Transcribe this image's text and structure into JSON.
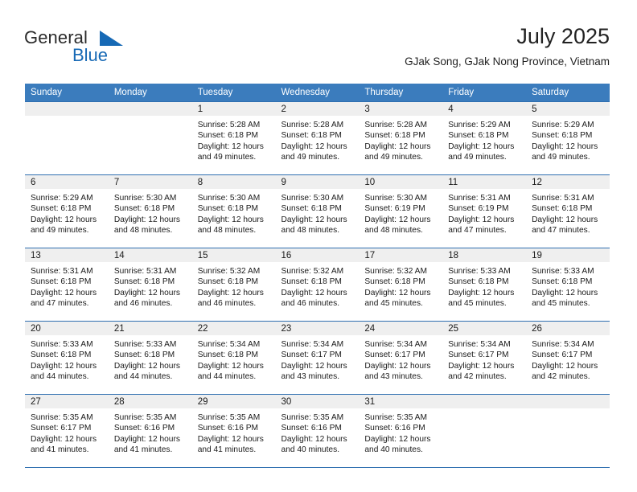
{
  "brand": {
    "name_part1": "General",
    "name_part2": "Blue",
    "triangle_icon": "blue-triangle-icon",
    "accent_color": "#1669b5"
  },
  "header": {
    "title": "July 2025",
    "subtitle": "GJak Song, GJak Nong Province, Vietnam"
  },
  "theme": {
    "header_row_bg": "#3b7cbd",
    "row_border": "#2f6fb0",
    "daynum_band_bg": "#efefef",
    "text_color": "#1a1a1a"
  },
  "weekday_headers": [
    "Sunday",
    "Monday",
    "Tuesday",
    "Wednesday",
    "Thursday",
    "Friday",
    "Saturday"
  ],
  "weeks": [
    [
      {
        "day": "",
        "empty": true,
        "sunrise": "",
        "sunset": "",
        "daylight1": "",
        "daylight2": ""
      },
      {
        "day": "",
        "empty": true,
        "sunrise": "",
        "sunset": "",
        "daylight1": "",
        "daylight2": ""
      },
      {
        "day": "1",
        "empty": false,
        "sunrise": "Sunrise: 5:28 AM",
        "sunset": "Sunset: 6:18 PM",
        "daylight1": "Daylight: 12 hours",
        "daylight2": "and 49 minutes."
      },
      {
        "day": "2",
        "empty": false,
        "sunrise": "Sunrise: 5:28 AM",
        "sunset": "Sunset: 6:18 PM",
        "daylight1": "Daylight: 12 hours",
        "daylight2": "and 49 minutes."
      },
      {
        "day": "3",
        "empty": false,
        "sunrise": "Sunrise: 5:28 AM",
        "sunset": "Sunset: 6:18 PM",
        "daylight1": "Daylight: 12 hours",
        "daylight2": "and 49 minutes."
      },
      {
        "day": "4",
        "empty": false,
        "sunrise": "Sunrise: 5:29 AM",
        "sunset": "Sunset: 6:18 PM",
        "daylight1": "Daylight: 12 hours",
        "daylight2": "and 49 minutes."
      },
      {
        "day": "5",
        "empty": false,
        "sunrise": "Sunrise: 5:29 AM",
        "sunset": "Sunset: 6:18 PM",
        "daylight1": "Daylight: 12 hours",
        "daylight2": "and 49 minutes."
      }
    ],
    [
      {
        "day": "6",
        "empty": false,
        "sunrise": "Sunrise: 5:29 AM",
        "sunset": "Sunset: 6:18 PM",
        "daylight1": "Daylight: 12 hours",
        "daylight2": "and 49 minutes."
      },
      {
        "day": "7",
        "empty": false,
        "sunrise": "Sunrise: 5:30 AM",
        "sunset": "Sunset: 6:18 PM",
        "daylight1": "Daylight: 12 hours",
        "daylight2": "and 48 minutes."
      },
      {
        "day": "8",
        "empty": false,
        "sunrise": "Sunrise: 5:30 AM",
        "sunset": "Sunset: 6:18 PM",
        "daylight1": "Daylight: 12 hours",
        "daylight2": "and 48 minutes."
      },
      {
        "day": "9",
        "empty": false,
        "sunrise": "Sunrise: 5:30 AM",
        "sunset": "Sunset: 6:18 PM",
        "daylight1": "Daylight: 12 hours",
        "daylight2": "and 48 minutes."
      },
      {
        "day": "10",
        "empty": false,
        "sunrise": "Sunrise: 5:30 AM",
        "sunset": "Sunset: 6:19 PM",
        "daylight1": "Daylight: 12 hours",
        "daylight2": "and 48 minutes."
      },
      {
        "day": "11",
        "empty": false,
        "sunrise": "Sunrise: 5:31 AM",
        "sunset": "Sunset: 6:19 PM",
        "daylight1": "Daylight: 12 hours",
        "daylight2": "and 47 minutes."
      },
      {
        "day": "12",
        "empty": false,
        "sunrise": "Sunrise: 5:31 AM",
        "sunset": "Sunset: 6:18 PM",
        "daylight1": "Daylight: 12 hours",
        "daylight2": "and 47 minutes."
      }
    ],
    [
      {
        "day": "13",
        "empty": false,
        "sunrise": "Sunrise: 5:31 AM",
        "sunset": "Sunset: 6:18 PM",
        "daylight1": "Daylight: 12 hours",
        "daylight2": "and 47 minutes."
      },
      {
        "day": "14",
        "empty": false,
        "sunrise": "Sunrise: 5:31 AM",
        "sunset": "Sunset: 6:18 PM",
        "daylight1": "Daylight: 12 hours",
        "daylight2": "and 46 minutes."
      },
      {
        "day": "15",
        "empty": false,
        "sunrise": "Sunrise: 5:32 AM",
        "sunset": "Sunset: 6:18 PM",
        "daylight1": "Daylight: 12 hours",
        "daylight2": "and 46 minutes."
      },
      {
        "day": "16",
        "empty": false,
        "sunrise": "Sunrise: 5:32 AM",
        "sunset": "Sunset: 6:18 PM",
        "daylight1": "Daylight: 12 hours",
        "daylight2": "and 46 minutes."
      },
      {
        "day": "17",
        "empty": false,
        "sunrise": "Sunrise: 5:32 AM",
        "sunset": "Sunset: 6:18 PM",
        "daylight1": "Daylight: 12 hours",
        "daylight2": "and 45 minutes."
      },
      {
        "day": "18",
        "empty": false,
        "sunrise": "Sunrise: 5:33 AM",
        "sunset": "Sunset: 6:18 PM",
        "daylight1": "Daylight: 12 hours",
        "daylight2": "and 45 minutes."
      },
      {
        "day": "19",
        "empty": false,
        "sunrise": "Sunrise: 5:33 AM",
        "sunset": "Sunset: 6:18 PM",
        "daylight1": "Daylight: 12 hours",
        "daylight2": "and 45 minutes."
      }
    ],
    [
      {
        "day": "20",
        "empty": false,
        "sunrise": "Sunrise: 5:33 AM",
        "sunset": "Sunset: 6:18 PM",
        "daylight1": "Daylight: 12 hours",
        "daylight2": "and 44 minutes."
      },
      {
        "day": "21",
        "empty": false,
        "sunrise": "Sunrise: 5:33 AM",
        "sunset": "Sunset: 6:18 PM",
        "daylight1": "Daylight: 12 hours",
        "daylight2": "and 44 minutes."
      },
      {
        "day": "22",
        "empty": false,
        "sunrise": "Sunrise: 5:34 AM",
        "sunset": "Sunset: 6:18 PM",
        "daylight1": "Daylight: 12 hours",
        "daylight2": "and 44 minutes."
      },
      {
        "day": "23",
        "empty": false,
        "sunrise": "Sunrise: 5:34 AM",
        "sunset": "Sunset: 6:17 PM",
        "daylight1": "Daylight: 12 hours",
        "daylight2": "and 43 minutes."
      },
      {
        "day": "24",
        "empty": false,
        "sunrise": "Sunrise: 5:34 AM",
        "sunset": "Sunset: 6:17 PM",
        "daylight1": "Daylight: 12 hours",
        "daylight2": "and 43 minutes."
      },
      {
        "day": "25",
        "empty": false,
        "sunrise": "Sunrise: 5:34 AM",
        "sunset": "Sunset: 6:17 PM",
        "daylight1": "Daylight: 12 hours",
        "daylight2": "and 42 minutes."
      },
      {
        "day": "26",
        "empty": false,
        "sunrise": "Sunrise: 5:34 AM",
        "sunset": "Sunset: 6:17 PM",
        "daylight1": "Daylight: 12 hours",
        "daylight2": "and 42 minutes."
      }
    ],
    [
      {
        "day": "27",
        "empty": false,
        "sunrise": "Sunrise: 5:35 AM",
        "sunset": "Sunset: 6:17 PM",
        "daylight1": "Daylight: 12 hours",
        "daylight2": "and 41 minutes."
      },
      {
        "day": "28",
        "empty": false,
        "sunrise": "Sunrise: 5:35 AM",
        "sunset": "Sunset: 6:16 PM",
        "daylight1": "Daylight: 12 hours",
        "daylight2": "and 41 minutes."
      },
      {
        "day": "29",
        "empty": false,
        "sunrise": "Sunrise: 5:35 AM",
        "sunset": "Sunset: 6:16 PM",
        "daylight1": "Daylight: 12 hours",
        "daylight2": "and 41 minutes."
      },
      {
        "day": "30",
        "empty": false,
        "sunrise": "Sunrise: 5:35 AM",
        "sunset": "Sunset: 6:16 PM",
        "daylight1": "Daylight: 12 hours",
        "daylight2": "and 40 minutes."
      },
      {
        "day": "31",
        "empty": false,
        "sunrise": "Sunrise: 5:35 AM",
        "sunset": "Sunset: 6:16 PM",
        "daylight1": "Daylight: 12 hours",
        "daylight2": "and 40 minutes."
      },
      {
        "day": "",
        "empty": true,
        "sunrise": "",
        "sunset": "",
        "daylight1": "",
        "daylight2": ""
      },
      {
        "day": "",
        "empty": true,
        "sunrise": "",
        "sunset": "",
        "daylight1": "",
        "daylight2": ""
      }
    ]
  ]
}
